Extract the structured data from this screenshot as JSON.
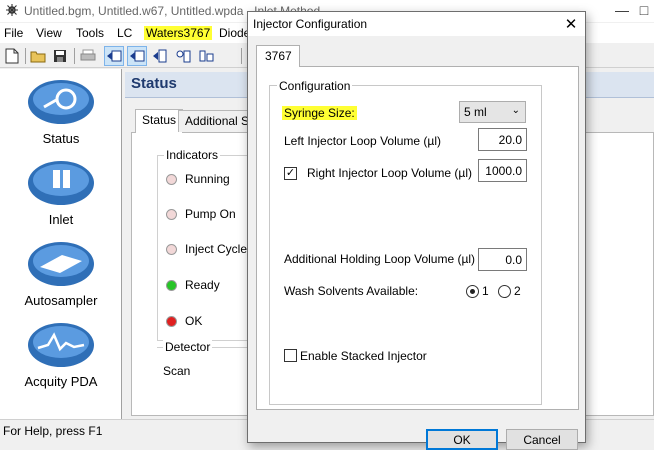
{
  "window": {
    "title": "Untitled.bgm, Untitled.w67, Untitled.wpda - Inlet Method"
  },
  "menu": {
    "items": [
      "File",
      "View",
      "Tools",
      "LC",
      "Waters3767",
      "Diode"
    ],
    "highlighted": "Waters3767"
  },
  "sidebar": {
    "items": [
      {
        "label": "Status",
        "icon": "status-gauge-icon"
      },
      {
        "label": "Inlet",
        "icon": "inlet-bottles-icon"
      },
      {
        "label": "Autosampler",
        "icon": "autosampler-tray-icon"
      },
      {
        "label": "Acquity PDA",
        "icon": "pda-spectrum-icon"
      }
    ]
  },
  "main": {
    "header": "Status",
    "tabs": [
      "Status",
      "Additional Sta"
    ],
    "indicators": {
      "legend": "Indicators",
      "items": [
        {
          "label": "Running",
          "color": "#f2d8d8"
        },
        {
          "label": "Pump On",
          "color": "#f2d8d8"
        },
        {
          "label": "Inject Cycle",
          "color": "#f2d8d8"
        },
        {
          "label": "Ready",
          "color": "#27c427"
        },
        {
          "label": "OK",
          "color": "#e02020"
        }
      ]
    },
    "detector": {
      "legend": "Detector",
      "scan_label": "Scan"
    }
  },
  "statusbar": {
    "text": "For Help, press F1"
  },
  "dialog": {
    "title": "Injector Configuration",
    "tab": "3767",
    "group_label": "Configuration",
    "syringe_size": {
      "label": "Syringe Size:",
      "value": "5 ml"
    },
    "left_loop": {
      "label": "Left Injector Loop Volume (µl)",
      "value": "20.0"
    },
    "right_loop": {
      "label": "Right Injector Loop Volume (µl)",
      "value": "1000.0",
      "checked": true
    },
    "holding_loop": {
      "label": "Additional Holding Loop Volume (µl)",
      "value": "0.0"
    },
    "wash": {
      "label": "Wash Solvents Available:",
      "options": [
        "1",
        "2"
      ],
      "selected": "1"
    },
    "stacked": {
      "label": "Enable Stacked Injector",
      "checked": false
    },
    "ok_label": "OK",
    "cancel_label": "Cancel"
  },
  "colors": {
    "accent": "#0078d7",
    "highlight": "#ffff33",
    "header_bg": "#dbe4f0"
  }
}
